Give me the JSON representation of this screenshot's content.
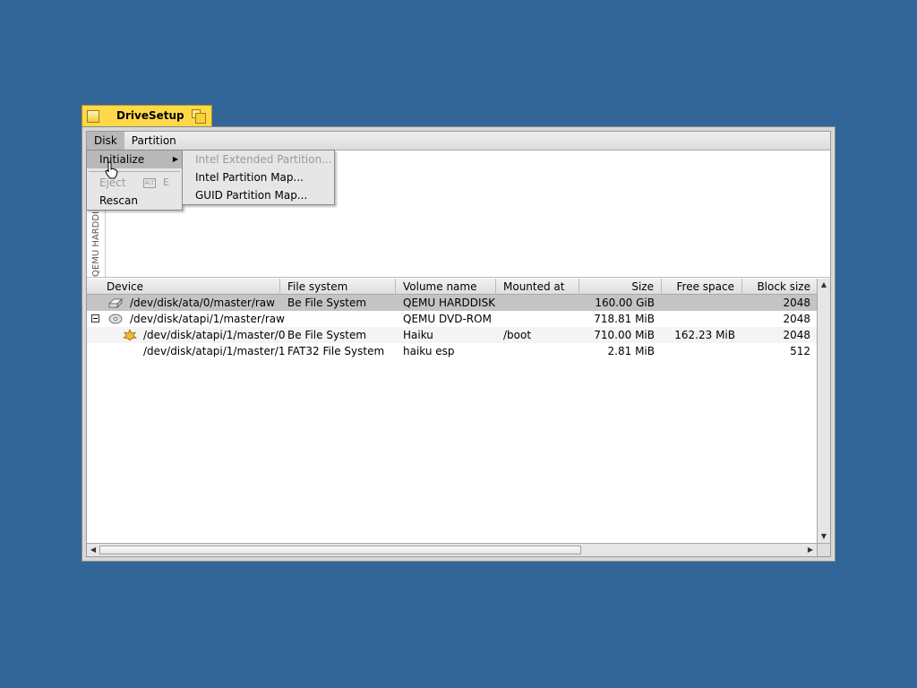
{
  "window": {
    "title": "DriveSetup",
    "tab_color": "#ffd84a"
  },
  "menubar": {
    "items": [
      {
        "label": "Disk",
        "open": true
      },
      {
        "label": "Partition",
        "open": false
      }
    ]
  },
  "disk_menu": {
    "items": [
      {
        "label": "Initialize",
        "has_submenu": true,
        "highlighted": true
      },
      {
        "label": "Eject",
        "disabled": true,
        "shortcut_modifier": "ALT",
        "shortcut_key": "E"
      },
      {
        "label": "Rescan",
        "disabled": false
      }
    ]
  },
  "initialize_submenu": {
    "items": [
      {
        "label": "Intel Extended Partition...",
        "disabled": true
      },
      {
        "label": "Intel Partition Map...",
        "disabled": false
      },
      {
        "label": "GUID Partition Map...",
        "disabled": false
      }
    ]
  },
  "disk_map": {
    "vertical_label": "QEMU HARDDISK"
  },
  "list": {
    "columns": [
      {
        "label": "Device"
      },
      {
        "label": "File system"
      },
      {
        "label": "Volume name"
      },
      {
        "label": "Mounted at"
      },
      {
        "label": "Size"
      },
      {
        "label": "Free space"
      },
      {
        "label": "Block size"
      }
    ],
    "rows": [
      {
        "icon": "harddisk-icon",
        "device": "/dev/disk/ata/0/master/raw",
        "filesystem": "Be File System",
        "volume": "QEMU HARDDISK",
        "mounted": "",
        "size": "160.00 GiB",
        "free": "",
        "block": "2048",
        "selected": true
      },
      {
        "icon": "cdrom-icon",
        "device": "/dev/disk/atapi/1/master/raw",
        "filesystem": "",
        "volume": "QEMU DVD-ROM",
        "mounted": "",
        "size": "718.81 MiB",
        "free": "",
        "block": "2048",
        "expanded": true
      },
      {
        "icon": "haiku-leaf-icon",
        "device": "/dev/disk/atapi/1/master/0",
        "filesystem": "Be File System",
        "volume": "Haiku",
        "mounted": "/boot",
        "size": "710.00 MiB",
        "free": "162.23 MiB",
        "block": "2048"
      },
      {
        "icon": "",
        "device": "/dev/disk/atapi/1/master/1",
        "filesystem": "FAT32 File System",
        "volume": "haiku esp",
        "mounted": "",
        "size": "2.81 MiB",
        "free": "",
        "block": "512"
      }
    ]
  }
}
